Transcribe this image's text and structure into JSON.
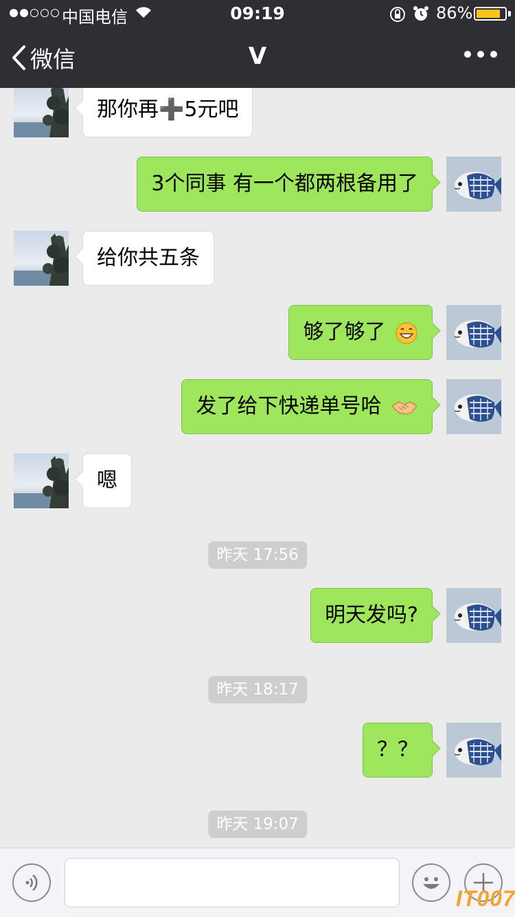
{
  "status_bar": {
    "carrier": "中国电信",
    "time": "09:19",
    "battery": "86%",
    "battery_level": 0.86
  },
  "nav": {
    "back_label": "微信",
    "title": "V",
    "more_icon": "more-dots-icon"
  },
  "messages": [
    {
      "side": "left",
      "text": "那你再➕5元吧"
    },
    {
      "side": "right",
      "text": "3个同事 有一个都两根备用了"
    },
    {
      "side": "left",
      "text": "给你共五条"
    },
    {
      "side": "right",
      "text": "够了够了",
      "emoji": "grin-emoji"
    },
    {
      "side": "right",
      "text": "发了给下快递单号哈",
      "emoji": "handshake-emoji"
    },
    {
      "side": "left",
      "text": "嗯"
    },
    {
      "timestamp": "昨天 17:56"
    },
    {
      "side": "right",
      "text": "明天发吗?"
    },
    {
      "timestamp": "昨天 18:17"
    },
    {
      "side": "right",
      "text": "？？"
    },
    {
      "timestamp": "昨天 19:07"
    }
  ],
  "input_bar": {
    "voice_icon": "voice-icon",
    "emoji_icon": "emoji-face-icon",
    "plus_icon": "plus-icon",
    "text_value": ""
  },
  "watermark": "IT007",
  "colors": {
    "header_bg": "#2f2e33",
    "chat_bg": "#ebebeb",
    "sent_bubble": "#9ee75c",
    "received_bubble": "#ffffff",
    "timestamp_bg": "#cecece",
    "battery_fill": "#f5c518"
  }
}
